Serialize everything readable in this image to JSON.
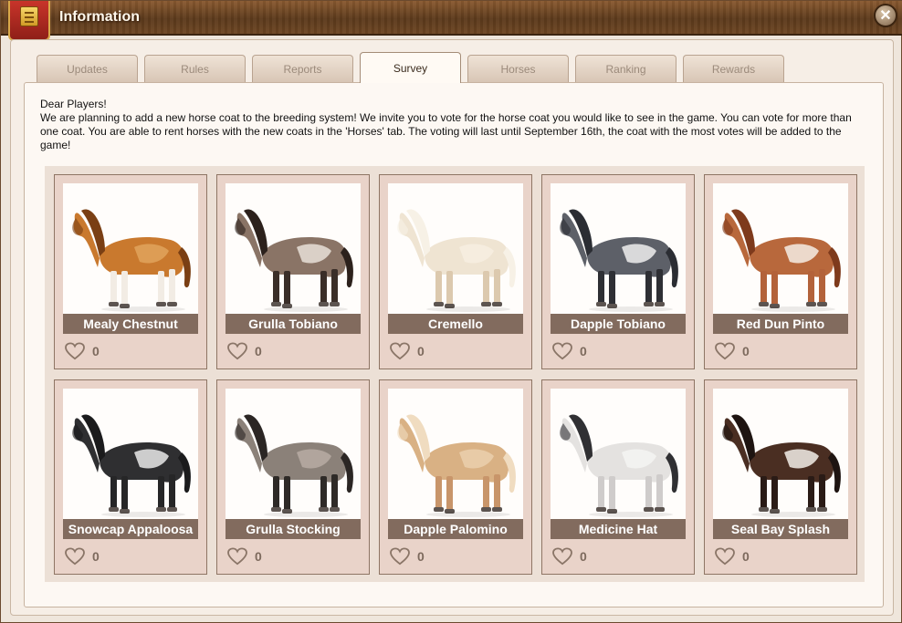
{
  "window": {
    "title": "Information",
    "close_glyph": "✕",
    "banner_icon": "scroll-icon"
  },
  "tabs": [
    {
      "label": "Updates",
      "active": false
    },
    {
      "label": "Rules",
      "active": false
    },
    {
      "label": "Reports",
      "active": false
    },
    {
      "label": "Survey",
      "active": true
    },
    {
      "label": "Horses",
      "active": false
    },
    {
      "label": "Ranking",
      "active": false
    },
    {
      "label": "Rewards",
      "active": false
    }
  ],
  "intro": {
    "greeting": "Dear Players!",
    "body": "We are planning to add a new horse coat to the breeding system! We invite you to vote for the horse coat you would like to see in the game. You can vote for more than one coat. You are able to rent horses with the new coats in the 'Horses' tab. The voting will last until September 16th, the coat with the most votes will be added to the game!"
  },
  "coats": [
    {
      "name": "Mealy Chestnut",
      "votes": "0",
      "body": "#c9792e",
      "mane": "#7a3f14",
      "legs": "#f2ece4",
      "patch": "#e0a35c"
    },
    {
      "name": "Grulla Tobiano",
      "votes": "0",
      "body": "#8a7466",
      "mane": "#2c211c",
      "legs": "#3a2e28",
      "patch": "#e8e0d8"
    },
    {
      "name": "Cremello",
      "votes": "0",
      "body": "#efe4d2",
      "mane": "#f7f1e6",
      "legs": "#dcc9ae",
      "patch": "#f7efe2"
    },
    {
      "name": "Dapple Tobiano",
      "votes": "0",
      "body": "#5d6068",
      "mane": "#2b2d33",
      "legs": "#2e2f34",
      "patch": "#eeeeee"
    },
    {
      "name": "Red Dun Pinto",
      "votes": "0",
      "body": "#b8683c",
      "mane": "#7e3a1c",
      "legs": "#b3623a",
      "patch": "#f4ede4"
    },
    {
      "name": "Snowcap Appaloosa",
      "votes": "0",
      "body": "#2f2f31",
      "mane": "#1b1b1c",
      "legs": "#262627",
      "patch": "#e9e9e9"
    },
    {
      "name": "Grulla Stocking",
      "votes": "0",
      "body": "#8b8179",
      "mane": "#2b2624",
      "legs": "#2e2a27",
      "patch": "#b7aca3"
    },
    {
      "name": "Dapple Palomino",
      "votes": "0",
      "body": "#d9b184",
      "mane": "#f0dcc0",
      "legs": "#c8956a",
      "patch": "#ead0ad"
    },
    {
      "name": "Medicine Hat",
      "votes": "0",
      "body": "#e4e2e0",
      "mane": "#303033",
      "legs": "#cfcccb",
      "patch": "#f5f4f2"
    },
    {
      "name": "Seal Bay Splash",
      "votes": "0",
      "body": "#4a2e22",
      "mane": "#1e1411",
      "legs": "#2a1b16",
      "patch": "#f2ede8"
    }
  ]
}
